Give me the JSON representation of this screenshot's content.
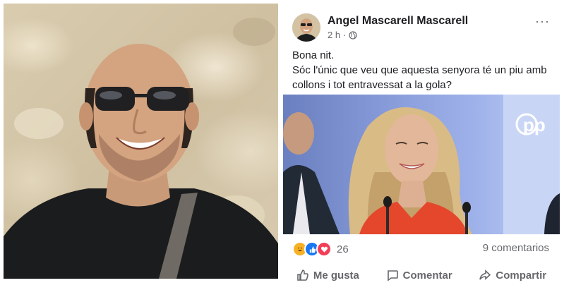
{
  "post": {
    "author": "Angel Mascarell Mascarell",
    "time": "2 h",
    "time_separator": "·",
    "more_icon": "···",
    "text_line1": "Bona nit.",
    "text_line2": "Sóc l'únic que veu que aquesta senyora té un piu amb collons i tot entravessat a la gola?",
    "image_logo_text": "pp",
    "reaction_count": "26",
    "comments_label": "9 comentarios",
    "actions": {
      "like": "Me gusta",
      "comment": "Comentar",
      "share": "Compartir"
    }
  },
  "icons": [
    "globe-icon",
    "haha-reaction-icon",
    "like-reaction-icon",
    "love-reaction-icon",
    "like-icon",
    "comment-icon",
    "share-icon",
    "more-options-icon"
  ],
  "colors": {
    "link": "#1877f2",
    "secondary_text": "#65676b",
    "primary_text": "#1c1e21",
    "love": "#f33e58",
    "haha": "#f7b125"
  }
}
